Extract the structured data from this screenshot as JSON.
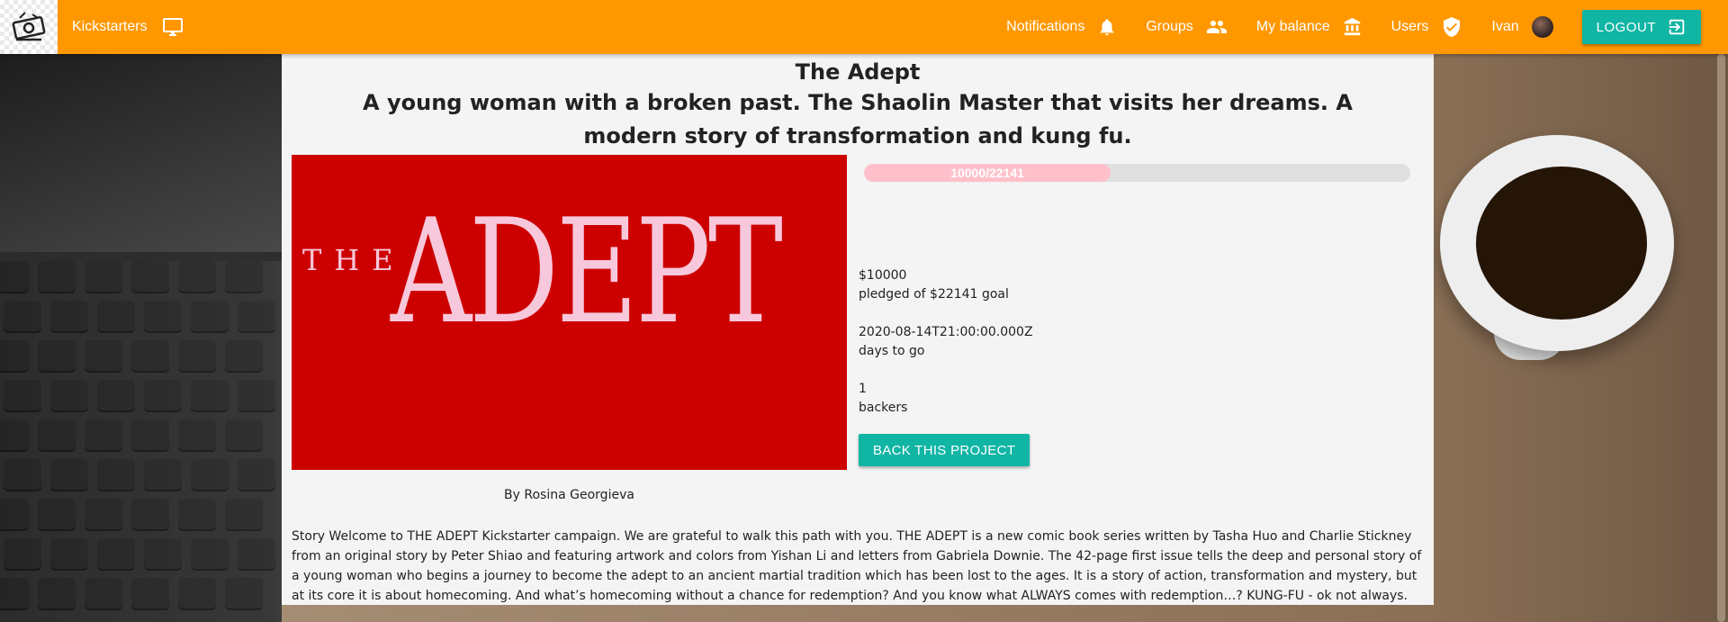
{
  "navbar": {
    "brand_label": "Kickstarters",
    "items": [
      {
        "label": "Notifications",
        "icon": "bell-icon"
      },
      {
        "label": "Groups",
        "icon": "group-icon"
      },
      {
        "label": "My balance",
        "icon": "bank-icon"
      },
      {
        "label": "Users",
        "icon": "verified-shield-icon"
      }
    ],
    "user_name": "Ivan",
    "logout_label": "LOGOUT",
    "accent_color": "#ff9800",
    "button_color": "#10b5a4"
  },
  "project": {
    "title": "The Adept",
    "subtitle": "A young woman with a broken past. The Shaolin Master that visits her dreams. A modern story of transformation and kung fu.",
    "image": {
      "text_small": "THE",
      "text_large": "ADEPT",
      "background": "#cd0000",
      "text_color": "#f7c8db"
    },
    "progress": {
      "text": "10000/22141",
      "current": 10000,
      "goal": 22141,
      "fill_color": "#ffc0cb"
    },
    "pledged_amount": "$10000",
    "pledged_label": "pledged of $22141 goal",
    "deadline": "2020-08-14T21:00:00.000Z",
    "deadline_label": "days to go",
    "backers_count": "1",
    "backers_label": "backers",
    "back_button_label": "BACK THIS PROJECT",
    "by_prefix": "By",
    "author": "Rosina Georgieva",
    "story": "Story Welcome to THE ADEPT Kickstarter campaign. We are grateful to walk this path with you. THE ADEPT is a new comic book series written by Tasha Huo and Charlie Stickney from an original story by Peter Shiao and featuring artwork and colors from Yishan Li and letters from Gabriela Downie. The 42-page first issue tells the deep and personal story of a young woman who begins a journey to become the adept to an ancient martial tradition which has been lost to the ages. It is a story of action, transformation and mystery, but at its core it is about homecoming. And what’s homecoming without a chance for redemption? And you know what ALWAYS comes with redemption…? KUNG-FU - ok not always. But ours does!"
  }
}
